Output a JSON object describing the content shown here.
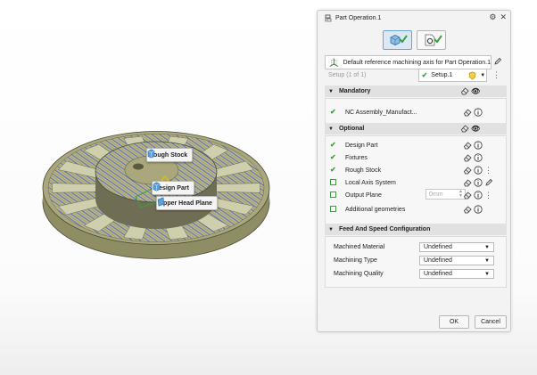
{
  "viewport": {
    "labels": {
      "rough_stock": "Rough Stock",
      "design_part": "Design Part",
      "upper_head_plane": "Upper Head Plane"
    },
    "colors": {
      "part": "#b9b78a",
      "toolpath": "#4f62c8",
      "outline": "#4a4a38"
    }
  },
  "dialog": {
    "title": "Part Operation.1",
    "title_buttons": [
      "gear-icon",
      "close-icon"
    ],
    "mode_tabs": [
      "part-operation-mode",
      "settings-mode"
    ],
    "axis_label": "Default reference machining axis for Part Operation.1",
    "setup_label": "Setup (1 of 1)",
    "setup_value": "Setup.1",
    "mandatory": {
      "header": "Mandatory",
      "items": [
        {
          "label": "NC Assembly_Manufact...",
          "status": "done"
        }
      ]
    },
    "optional": {
      "header": "Optional",
      "items": [
        {
          "label": "Design Part",
          "status": "done"
        },
        {
          "label": "Fixtures",
          "status": "empty"
        },
        {
          "label": "Rough Stock",
          "status": "done"
        },
        {
          "label": "Local Axis System",
          "status": "done"
        },
        {
          "label": "Output Plane",
          "status": "empty",
          "placeholder": "0mm"
        },
        {
          "label": "Additional geometries",
          "status": "empty"
        }
      ]
    },
    "feed": {
      "header": "Feed And Speed Configuration",
      "rows": [
        {
          "label": "Machined Material",
          "value": "Undefined"
        },
        {
          "label": "Machining Type",
          "value": "Undefined"
        },
        {
          "label": "Machining Quality",
          "value": "Undefined"
        }
      ]
    },
    "ok_label": "OK",
    "cancel_label": "Cancel",
    "accent": "#3ba03b"
  }
}
